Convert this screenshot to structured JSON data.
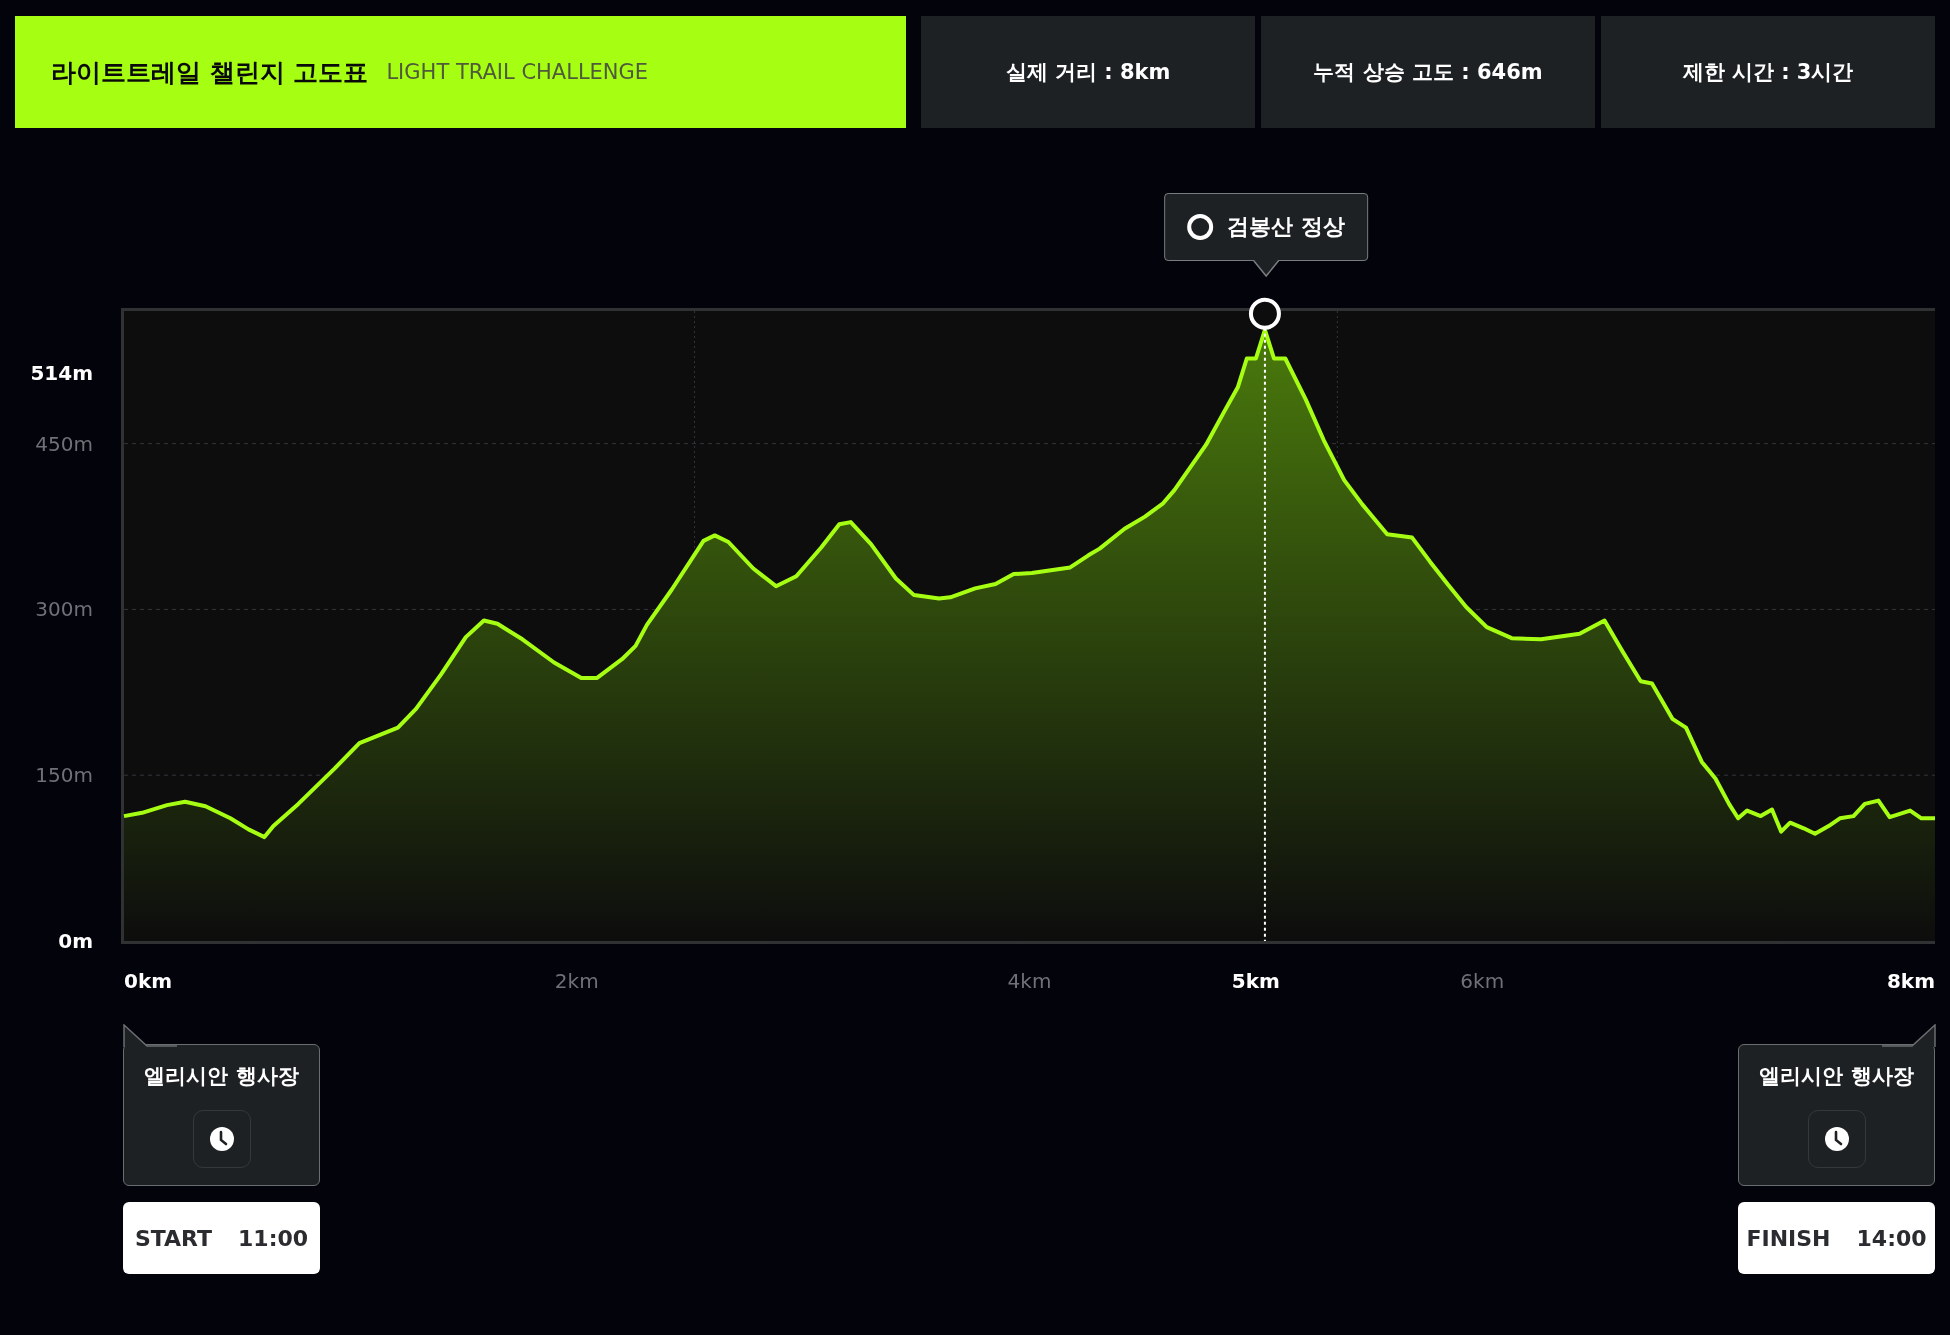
{
  "header": {
    "title": "라이트트레일 챌린지 고도표",
    "subtitle": "LIGHT TRAIL CHALLENGE"
  },
  "stats": [
    "실제 거리 : 8km",
    "누적 상승 고도 : 646m",
    "제한 시간 : 3시간"
  ],
  "chart_data": {
    "type": "area",
    "ylim": [
      0,
      570
    ],
    "xlim": [
      0,
      8
    ],
    "yticks": [
      {
        "value": 514,
        "label": "514m"
      },
      {
        "value": 450,
        "label": "450m"
      },
      {
        "value": 300,
        "label": "300m"
      },
      {
        "value": 150,
        "label": "150m"
      },
      {
        "value": 0,
        "label": "0m"
      }
    ],
    "xticks": [
      {
        "value": 0,
        "label": "0km"
      },
      {
        "value": 2,
        "label": "2km"
      },
      {
        "value": 4,
        "label": "4km"
      },
      {
        "value": 5,
        "label": "5km"
      },
      {
        "value": 6,
        "label": "6km"
      },
      {
        "value": 8,
        "label": "8km"
      }
    ],
    "x": [
      0,
      0.08,
      0.19,
      0.27,
      0.36,
      0.47,
      0.55,
      0.62,
      0.66,
      0.77,
      0.93,
      1.04,
      1.21,
      1.29,
      1.4,
      1.51,
      1.59,
      1.65,
      1.76,
      1.9,
      2.02,
      2.09,
      2.2,
      2.26,
      2.31,
      2.42,
      2.56,
      2.61,
      2.67,
      2.78,
      2.88,
      2.97,
      3.08,
      3.16,
      3.21,
      3.3,
      3.41,
      3.49,
      3.6,
      3.65,
      3.76,
      3.85,
      3.93,
      4.01,
      4.18,
      4.26,
      4.31,
      4.42,
      4.51,
      4.59,
      4.64,
      4.78,
      4.86,
      4.92,
      4.96,
      5,
      5.04,
      5.08,
      5.13,
      5.22,
      5.3,
      5.39,
      5.47,
      5.58,
      5.69,
      5.77,
      5.85,
      5.93,
      6.02,
      6.13,
      6.26,
      6.43,
      6.54,
      6.62,
      6.7,
      6.75,
      6.84,
      6.9,
      6.97,
      7.03,
      7.09,
      7.13,
      7.17,
      7.23,
      7.28,
      7.32,
      7.36,
      7.42,
      7.47,
      7.53,
      7.58,
      7.64,
      7.69,
      7.75,
      7.8,
      7.89,
      7.94,
      8
    ],
    "series": [
      {
        "color": "#a6ff12",
        "values": [
          113,
          116,
          123,
          126,
          122,
          111,
          101,
          94,
          104,
          124,
          156,
          179,
          193,
          210,
          241,
          275,
          290,
          287,
          273,
          252,
          238,
          238,
          255,
          267,
          286,
          318,
          362,
          367,
          361,
          337,
          321,
          330,
          356,
          377,
          379,
          359,
          328,
          313,
          310,
          311,
          319,
          323,
          332,
          333,
          338,
          349,
          355,
          373,
          384,
          396,
          408,
          449,
          479,
          501,
          527,
          527,
          553,
          527,
          527,
          490,
          453,
          417,
          395,
          368,
          365,
          343,
          322,
          302,
          284,
          274,
          273,
          278,
          290,
          262,
          235,
          233,
          201,
          193,
          162,
          147,
          124,
          111,
          118,
          113,
          119,
          99,
          107,
          102,
          97,
          104,
          111,
          113,
          124,
          127,
          112,
          118,
          111,
          111
        ]
      }
    ],
    "annotations": [
      "검봉산 정상"
    ],
    "grid": true,
    "ref_lines": [
      {
        "axis": "x",
        "value": 5.04
      }
    ]
  },
  "route_points": [
    {
      "kind": "start",
      "place": "엘리시안 행사장",
      "label": "START",
      "time": "11:00"
    },
    {
      "kind": "finish",
      "place": "엘리시안 행사장",
      "label": "FINISH",
      "time": "14:00"
    }
  ]
}
